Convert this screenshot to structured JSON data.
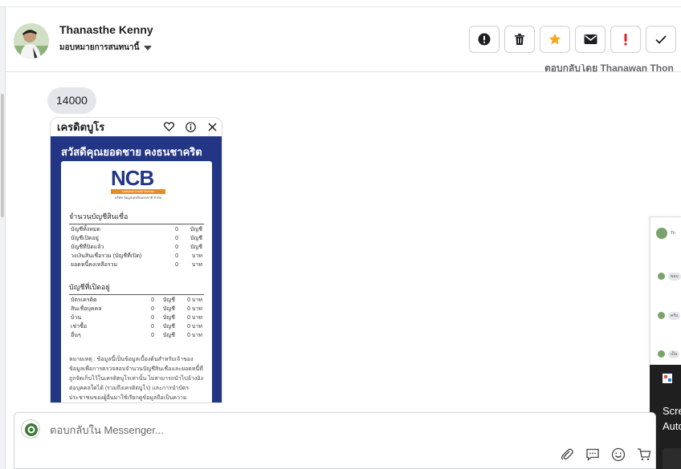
{
  "header": {
    "contact_name": "Thanasthe Kenny",
    "assign_label": "มอบหมายการสนทนานี้",
    "faded_text": "ตอบกลับโดย Thanawan Thon",
    "actions": [
      {
        "icon": "exclamation-circle-icon",
        "color": "#1c1e21"
      },
      {
        "icon": "trash-icon",
        "color": "#1c1e21"
      },
      {
        "icon": "star-icon",
        "color": "#f5a623"
      },
      {
        "icon": "envelope-icon",
        "color": "#1c1e21"
      },
      {
        "icon": "exclamation-icon",
        "color": "#e02424"
      },
      {
        "icon": "check-icon",
        "color": "#1c1e21"
      }
    ]
  },
  "chat": {
    "message_bubble": "14000",
    "card": {
      "title": "เครดิตบูโร",
      "greeting": "สวัสดีคุณยอดชาย คงธนชาคริต",
      "logo": {
        "text": "NCB",
        "bar_text": "National Credit Bureau",
        "sub_text": "บริษัท ข้อมูลเครดิตแห่งชาติ จำกัด"
      },
      "section1": {
        "title": "จำนวนบัญชีสินเชื่อ",
        "rows": [
          {
            "label": "บัญชีทั้งหมด",
            "value": "0",
            "unit": "บัญชี"
          },
          {
            "label": "บัญชีเปิดอยู่",
            "value": "0",
            "unit": "บัญชี"
          },
          {
            "label": "บัญชีที่ปิดแล้ว",
            "value": "0",
            "unit": "บัญชี"
          },
          {
            "label": "วงเงินสินเชื่อรวม (บัญชีที่เปิด)",
            "value": "0",
            "unit": "บาท"
          },
          {
            "label": "ยอดหนี้คงเหลือรวม",
            "value": "0",
            "unit": "บาท"
          }
        ]
      },
      "section2": {
        "title": "บัญชีที่เปิดอยู่",
        "rows": [
          {
            "label": "บัตรเครดิต",
            "count": "0",
            "count_unit": "บัญชี",
            "amount": "0 บาท"
          },
          {
            "label": "สินเชื่อบุคคล",
            "count": "0",
            "count_unit": "บัญชี",
            "amount": "0 บาท"
          },
          {
            "label": "บ้าน",
            "count": "0",
            "count_unit": "บัญชี",
            "amount": "0 บาท"
          },
          {
            "label": "เช่าซื้อ",
            "count": "0",
            "count_unit": "บัญชี",
            "amount": "0 บาท"
          },
          {
            "label": "อื่นๆ",
            "count": "0",
            "count_unit": "บัญชี",
            "amount": "0 บาท"
          }
        ]
      },
      "note": "หมายเหตุ : ข้อมูลนี้เป็นข้อมูลเบื้องต้นสำหรับเจ้าของข้อมูลเพื่อการตรวจสอบจำนวนบัญชีสินเชื่อและยอดหนี้ที่ถูกจัดเก็บไว้ในเครดิตบูโรเท่านั้น ไม่สามารถนำไปอ้างอิงต่อบุคคลใดได้ (รวมถึงเครดิตบูโร) และการนำบัตรประชาชนของผู้อื่นมาใช้เรียกดูข้อมูลถือเป็นความ"
    }
  },
  "side_window": {
    "header_label": "Th",
    "items": [
      "ขอบ",
      "ครับ",
      "เป็น"
    ]
  },
  "notification": {
    "line1": "Screen",
    "line2": "Autom"
  },
  "composer": {
    "placeholder": "ตอบกลับใน Messenger..."
  }
}
